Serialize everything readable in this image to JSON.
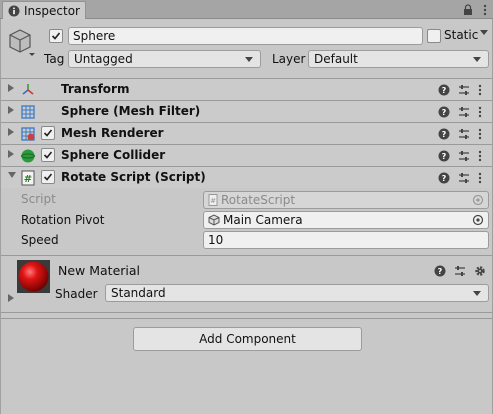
{
  "tab": {
    "title": "Inspector"
  },
  "gameobject": {
    "name": "Sphere",
    "static_label": "Static",
    "active_checked": true,
    "static_checked": false,
    "tag_label": "Tag",
    "tag_value": "Untagged",
    "layer_label": "Layer",
    "layer_value": "Default"
  },
  "components": [
    {
      "title": "Transform",
      "icon": "transform-icon",
      "has_checkbox": false
    },
    {
      "title": "Sphere (Mesh Filter)",
      "icon": "mesh-filter-icon",
      "has_checkbox": false
    },
    {
      "title": "Mesh Renderer",
      "icon": "mesh-renderer-icon",
      "has_checkbox": true
    },
    {
      "title": "Sphere Collider",
      "icon": "sphere-collider-icon",
      "has_checkbox": true
    },
    {
      "title": "Rotate Script (Script)",
      "icon": "script-icon",
      "has_checkbox": true,
      "expanded": true
    }
  ],
  "script": {
    "script_label": "Script",
    "script_value": "RotateScript",
    "rotation_pivot_label": "Rotation Pivot",
    "rotation_pivot_value": "Main Camera",
    "speed_label": "Speed",
    "speed_value": "10"
  },
  "material": {
    "name": "New Material",
    "shader_label": "Shader",
    "shader_value": "Standard",
    "preview_color": "#d01010"
  },
  "add_component_label": "Add Component",
  "colors": {
    "panel_bg": "#c8c8c8",
    "header_bg": "#cbcbcb",
    "accent_green": "#2a9a3a",
    "accent_blue": "#3a7ac8"
  }
}
